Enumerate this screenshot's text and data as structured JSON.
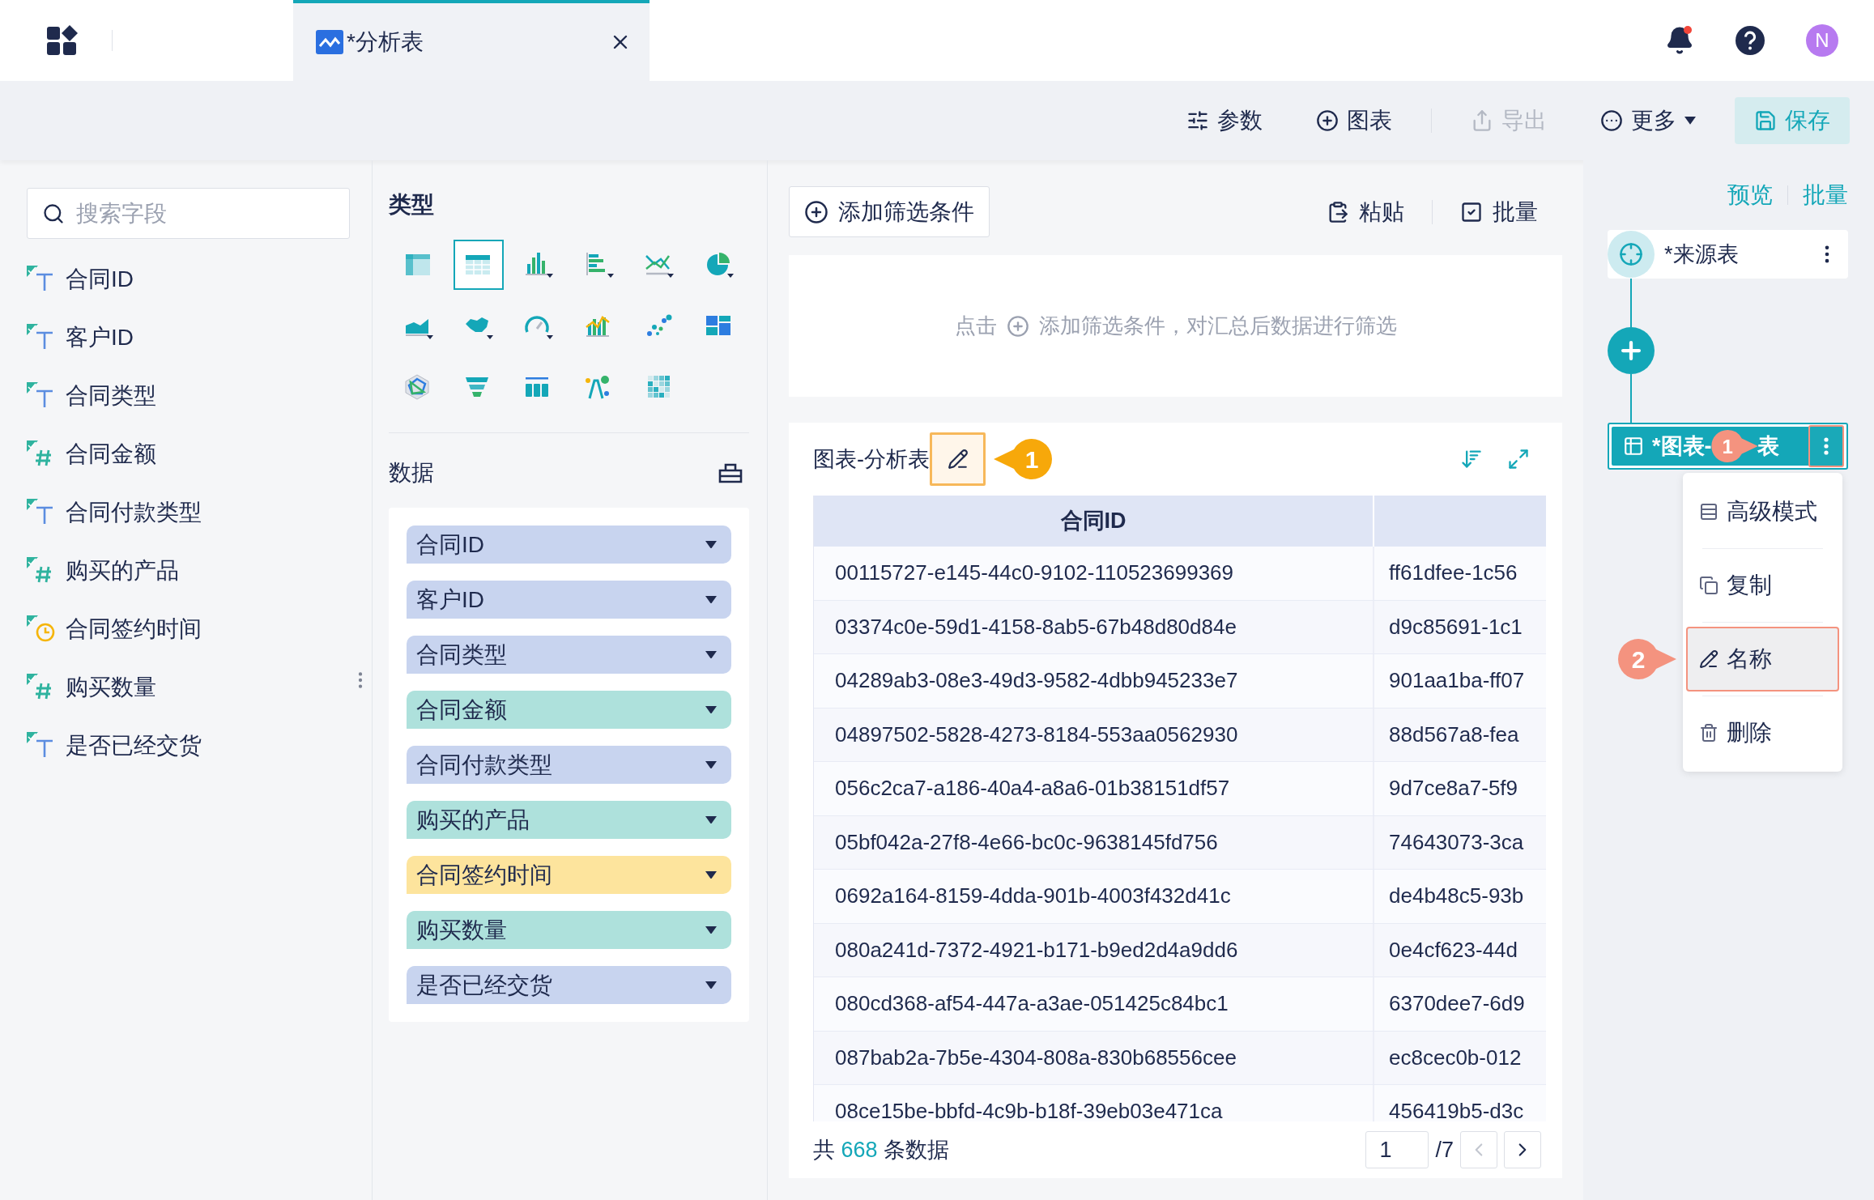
{
  "top_bar": {
    "tab": {
      "title": "*分析表",
      "selected": true
    },
    "notification": true,
    "avatar": "N"
  },
  "toolbar": {
    "buttons": [
      {
        "label": "参数",
        "kind": "params",
        "disabled": false
      },
      {
        "label": "图表",
        "kind": "add",
        "disabled": false
      },
      {
        "label": "导出",
        "kind": "export",
        "disabled": true
      },
      {
        "label": "更多",
        "kind": "more",
        "disabled": false
      },
      {
        "label": "保存",
        "kind": "save",
        "disabled": false
      }
    ]
  },
  "fields_panel": {
    "search": {
      "placeholder": "搜索字段"
    },
    "fields": [
      {
        "name": "合同ID",
        "kind": "text"
      },
      {
        "name": "客户ID",
        "kind": "text"
      },
      {
        "name": "合同类型",
        "kind": "text"
      },
      {
        "name": "合同金额",
        "kind": "number"
      },
      {
        "name": "合同付款类型",
        "kind": "text"
      },
      {
        "name": "购买的产品",
        "kind": "number"
      },
      {
        "name": "合同签约时间",
        "kind": "date"
      },
      {
        "name": "购买数量",
        "kind": "number"
      },
      {
        "name": "是否已经交货",
        "kind": "text"
      }
    ]
  },
  "type_panel": {
    "title": "类型",
    "chart_types": [
      {
        "kind": "crosstab",
        "selected": false
      },
      {
        "kind": "table",
        "selected": true
      },
      {
        "kind": "bar",
        "selected": false
      },
      {
        "kind": "hbar",
        "selected": false
      },
      {
        "kind": "line",
        "selected": false
      },
      {
        "kind": "pie",
        "selected": false
      },
      {
        "kind": "area",
        "selected": false
      },
      {
        "kind": "map",
        "selected": false
      },
      {
        "kind": "gauge",
        "selected": false
      },
      {
        "kind": "combo",
        "selected": false
      },
      {
        "kind": "scatter",
        "selected": false
      },
      {
        "kind": "treemap",
        "selected": false
      },
      {
        "kind": "radar",
        "selected": false
      },
      {
        "kind": "funnel",
        "selected": false
      },
      {
        "kind": "kpi",
        "selected": false
      },
      {
        "kind": "wordcloud",
        "selected": false
      },
      {
        "kind": "heatmap",
        "selected": false
      }
    ],
    "data_title": "数据",
    "data_fields": [
      {
        "name": "合同ID",
        "kind": "dimension"
      },
      {
        "name": "客户ID",
        "kind": "dimension"
      },
      {
        "name": "合同类型",
        "kind": "dimension"
      },
      {
        "name": "合同金额",
        "kind": "measure"
      },
      {
        "name": "合同付款类型",
        "kind": "dimension"
      },
      {
        "name": "购买的产品",
        "kind": "measure"
      },
      {
        "name": "合同签约时间",
        "kind": "date"
      },
      {
        "name": "购买数量",
        "kind": "measure"
      },
      {
        "name": "是否已经交货",
        "kind": "dimension"
      }
    ]
  },
  "filter": {
    "add_button": "添加筛选条件",
    "paste": "粘贴",
    "batch": "批量",
    "hint_before": "点击",
    "hint_after": "添加筛选条件，对汇总后数据进行筛选"
  },
  "chart": {
    "title": "图表-分析表",
    "callout": {
      "label": "1",
      "color": "#f7a80a"
    },
    "table": {
      "columns": [
        "合同ID"
      ],
      "rows": [
        [
          "00115727-e145-44c0-9102-110523699369",
          "ff61dfee-1c56"
        ],
        [
          "03374c0e-59d1-4158-8ab5-67b48d80d84e",
          "d9c85691-1c1"
        ],
        [
          "04289ab3-08e3-49d3-9582-4dbb945233e7",
          "901aa1ba-ff07"
        ],
        [
          "04897502-5828-4273-8184-553aa0562930",
          "88d567a8-fea"
        ],
        [
          "056c2ca7-a186-40a4-a8a6-01b38151df57",
          "9d7ce8a7-5f9"
        ],
        [
          "05bf042a-27f8-4e66-bc0c-9638145fd756",
          "74643073-3ca"
        ],
        [
          "0692a164-8159-4dda-901b-4003f432d41c",
          "de4b48c5-93b"
        ],
        [
          "080a241d-7372-4921-b171-b9ed2d4a9dd6",
          "0e4cf623-44d"
        ],
        [
          "080cd368-af54-447a-a3ae-051425c84bc1",
          "6370dee7-6d9"
        ],
        [
          "087bab2a-7b5e-4304-808a-830b68556cee",
          "ec8cec0b-012"
        ],
        [
          "08ce15be-bbfd-4c9b-b18f-39eb03e471ca",
          "456419b5-d3c"
        ]
      ]
    },
    "footer": {
      "total_before": "共",
      "total": "668",
      "total_after": "条数据",
      "page": "1",
      "pages": "/7"
    }
  },
  "flow_panel": {
    "links": [
      "预览",
      "批量"
    ],
    "nodes": [
      {
        "kind": "source",
        "name": "*来源表",
        "selected": false
      },
      {
        "kind": "add"
      },
      {
        "kind": "chart",
        "name_before": "*图表-",
        "name_after": "表",
        "selected": true,
        "callout": {
          "label": "1",
          "color": "#f4937f"
        }
      }
    ],
    "menu": {
      "items": [
        {
          "label": "高级模式",
          "kind": "advanced",
          "selected": false
        },
        {
          "label": "复制",
          "kind": "copy",
          "selected": false
        },
        {
          "label": "名称",
          "kind": "rename",
          "selected": true
        },
        {
          "label": "删除",
          "kind": "delete",
          "selected": false
        }
      ],
      "callout": {
        "label": "2",
        "color": "#f4937f"
      }
    }
  }
}
